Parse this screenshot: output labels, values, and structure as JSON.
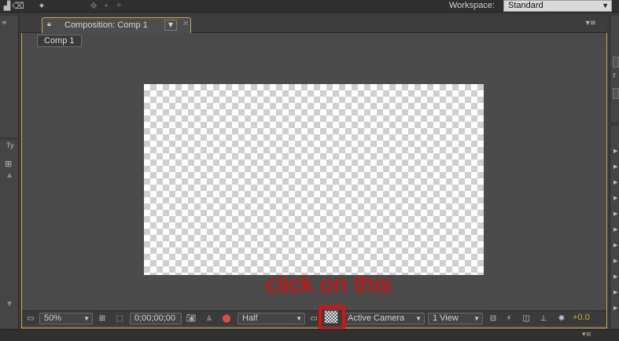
{
  "workspace": {
    "label": "Workspace:",
    "value": "Standard"
  },
  "left_panel": {
    "tab_label": "Ty"
  },
  "composition": {
    "tab_label": "Composition: Comp 1",
    "breadcrumb": "Comp 1"
  },
  "annotation": {
    "text": "click on this",
    "color": "#e10b0b"
  },
  "bottom_bar": {
    "zoom": "50%",
    "timecode": "0;00;00;00",
    "resolution": "Half",
    "camera": "Active Camera",
    "views": "1 View",
    "exposure": "+0.0"
  },
  "colors": {
    "panel_focus_border": "#c8a64b",
    "highlight": "#e00f0f"
  }
}
